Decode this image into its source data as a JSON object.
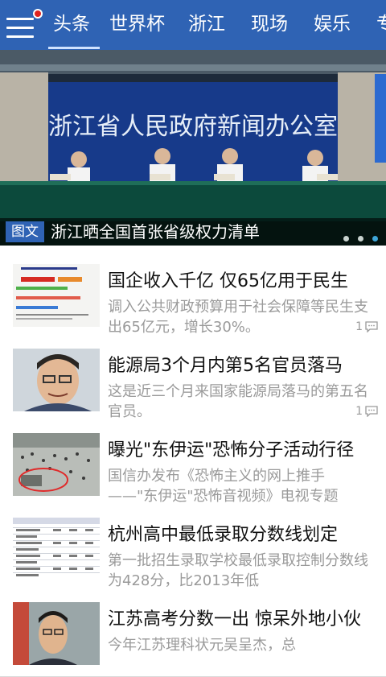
{
  "header": {
    "tabs": [
      {
        "label": "头条",
        "active": true
      },
      {
        "label": "世界杯",
        "active": false
      },
      {
        "label": "浙江",
        "active": false
      },
      {
        "label": "现场",
        "active": false
      },
      {
        "label": "娱乐",
        "active": false
      },
      {
        "label": "专",
        "active": false
      }
    ]
  },
  "banner": {
    "backdrop_text": "浙江省人民政府新闻办公室",
    "tag": "图文",
    "title": "浙江晒全国首张省级权力清单",
    "slide_index": 3,
    "slide_count": 3
  },
  "news": [
    {
      "title": "国企收入千亿 仅65亿用于民生",
      "summary": "调入公共财政预算用于社会保障等民生支出65亿元，增长30%。",
      "comments": "1",
      "thumb": "chart"
    },
    {
      "title": "能源局3个月内第5名官员落马",
      "summary": "这是近三个月来国家能源局落马的第五名官员。",
      "comments": "1",
      "thumb": "portrait"
    },
    {
      "title": "曝光\"东伊运\"恐怖分子活动行径",
      "summary": "国信办发布《恐怖主义的网上推手——\"东伊运\"恐怖音视频》电视专题",
      "comments": "",
      "thumb": "crowd"
    },
    {
      "title": "杭州高中最低录取分数线划定",
      "summary": "第一批招生录取学校最低录取控制分数线为428分，比2013年低",
      "comments": "",
      "thumb": "table"
    },
    {
      "title": "江苏高考分数一出 惊呆外地小伙",
      "summary": "今年江苏理科状元吴呈杰，总",
      "comments": "",
      "thumb": "portrait2"
    }
  ],
  "colors": {
    "header_bg": "#2f63b4",
    "accent_red": "#e0231f",
    "summary_text": "#9a9a9a"
  }
}
